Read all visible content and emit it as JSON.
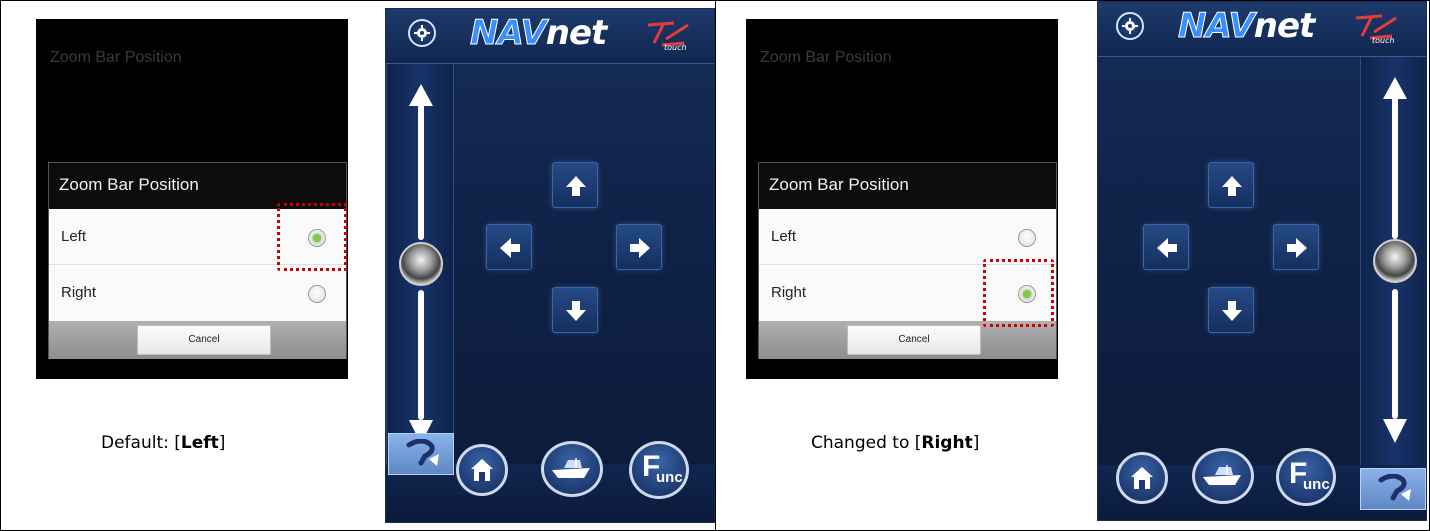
{
  "left_panel": {
    "dialog_bg_title": "Zoom Bar Position",
    "dialog_title": "Zoom Bar Position",
    "options": [
      {
        "label": "Left",
        "selected": true
      },
      {
        "label": "Right",
        "selected": false
      }
    ],
    "cancel_label": "Cancel",
    "caption_prefix": "Default: [",
    "caption_value": "Left",
    "caption_suffix": "]"
  },
  "right_panel": {
    "dialog_bg_title": "Zoom Bar Position",
    "dialog_title": "Zoom Bar Position",
    "options": [
      {
        "label": "Left",
        "selected": false
      },
      {
        "label": "Right",
        "selected": true
      }
    ],
    "cancel_label": "Cancel",
    "caption_prefix": "Changed to [",
    "caption_value": "Right",
    "caption_suffix": "]"
  },
  "device": {
    "logo_prefix": "NAV",
    "logo_main": "net",
    "logo_sub": "touch",
    "func_big": "F",
    "func_small": "unc"
  },
  "colors": {
    "highlight": "#d00000",
    "radio_checked": "#7fc84a",
    "device_bg": "#0f2247",
    "help_btn": "#7aa3e0"
  },
  "icons": [
    "settings-icon",
    "arrow-up-icon",
    "arrow-down-icon",
    "arrow-left-icon",
    "arrow-right-icon",
    "home-icon",
    "boat-icon",
    "help-icon",
    "zoom-knob-icon"
  ]
}
